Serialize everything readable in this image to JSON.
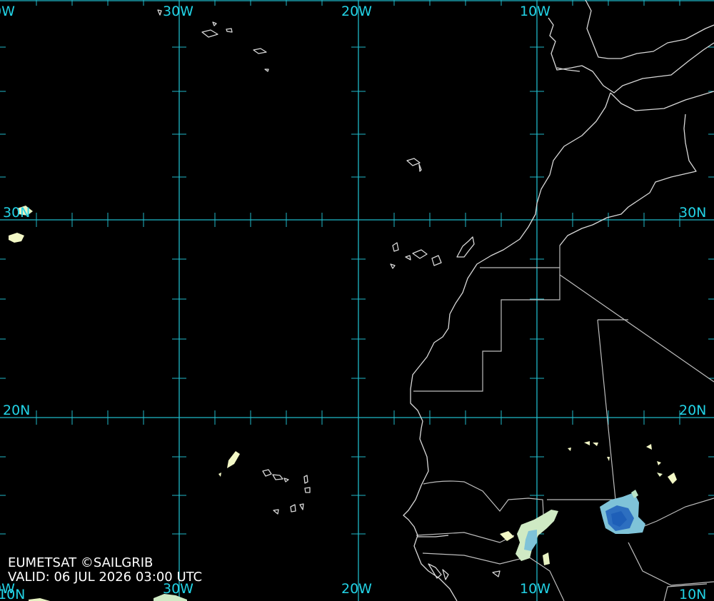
{
  "map": {
    "longitude_labels_top": [
      "0W",
      "30W",
      "20W",
      "10W"
    ],
    "longitude_labels_bottom": [
      "0W",
      "30W",
      "20W",
      "10W"
    ],
    "latitude_labels_left": [
      "30N",
      "20N",
      "10N"
    ],
    "latitude_labels_right": [
      "30N",
      "20N",
      "10N"
    ],
    "grid_color": "#1fb8c8",
    "coastline_color": "#d8d8d8",
    "background_color": "#000000",
    "cloud_colors": [
      "#f3f8c6",
      "#b9e3c6",
      "#5fa9d6",
      "#1e5fb8"
    ]
  },
  "credit": {
    "line1": "EUMETSAT ©SAILGRIB",
    "line2": "VALID:  06 JUL 2026 03:00 UTC"
  }
}
